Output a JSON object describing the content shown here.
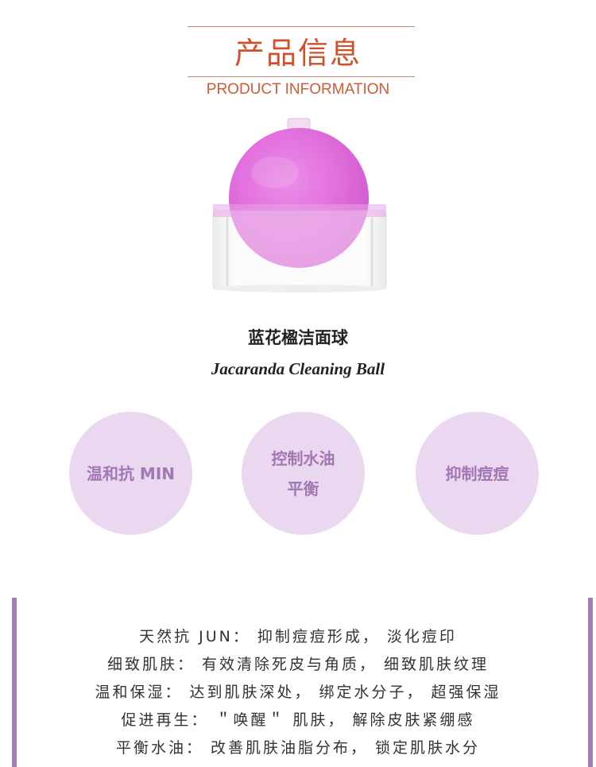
{
  "header": {
    "title_cn": "产品信息",
    "title_en": "PRODUCT INFORMATION"
  },
  "product": {
    "name_cn": "蓝花楹洁面球",
    "name_en": "Jacaranda Cleaning Ball"
  },
  "features": [
    {
      "lines": [
        "温和抗 MIN"
      ]
    },
    {
      "lines": [
        "控制水油",
        "平衡"
      ]
    },
    {
      "lines": [
        "抑制痘痘"
      ]
    }
  ],
  "description": [
    "天然抗 JUN： 抑制痘痘形成， 淡化痘印",
    "细致肌肤： 有效清除死皮与角质， 细致肌肤纹理",
    "温和保湿： 达到肌肤深处， 绑定水分子， 超强保湿",
    "促进再生： ＂唤醒＂ 肌肤， 解除皮肤紧绷感",
    "平衡水油： 改善肌肤油脂分布， 锁定肌肤水分"
  ],
  "colors": {
    "accent": "#d0502c",
    "circle_bg": "#ead8f0",
    "circle_text": "#a277b4",
    "side_bar": "#a27cb4"
  }
}
